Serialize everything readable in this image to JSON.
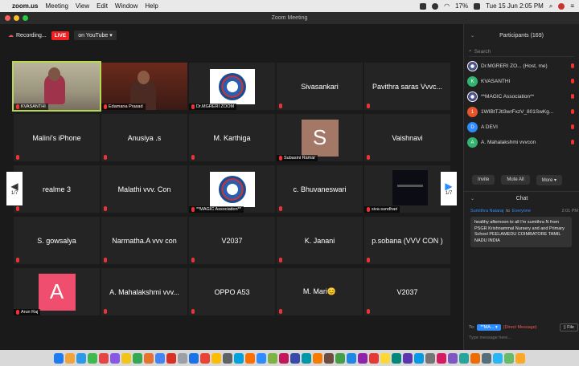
{
  "menubar": {
    "apple": "",
    "app": "zoom.us",
    "items": [
      "Meeting",
      "View",
      "Edit",
      "Window",
      "Help"
    ],
    "battery": "17%",
    "datetime": "Tue 15 Jun  2:05 PM"
  },
  "window": {
    "title": "Zoom Meeting"
  },
  "toolbar": {
    "recording": "Recording...",
    "live": "LIVE",
    "youtube": "on YouTube"
  },
  "tiles": [
    {
      "label": "",
      "name": "KVASANTHI",
      "kind": "video-kv"
    },
    {
      "label": "",
      "name": "Edamana Prasad",
      "kind": "video-ep"
    },
    {
      "label": "",
      "name": "Dr.MGRERI ZOOM",
      "kind": "logo"
    },
    {
      "label": "Sivasankari",
      "name": "",
      "kind": "text"
    },
    {
      "label": "Pavithra saras Vvvc...",
      "name": "",
      "kind": "text"
    },
    {
      "label": "Malini's iPhone",
      "name": "",
      "kind": "text"
    },
    {
      "label": "Anusiya .s",
      "name": "",
      "kind": "text"
    },
    {
      "label": "M. Karthiga",
      "name": "",
      "kind": "text"
    },
    {
      "label": "S",
      "name": "Subasini Ramar",
      "kind": "avatar",
      "color": "#a47866"
    },
    {
      "label": "Vaishnavi",
      "name": "",
      "kind": "text"
    },
    {
      "label": "realme 3",
      "name": "",
      "kind": "text"
    },
    {
      "label": "Malathi vvv. Con",
      "name": "",
      "kind": "text"
    },
    {
      "label": "",
      "name": "**MAGIC Association**",
      "kind": "logo"
    },
    {
      "label": "c. Bhuvaneswari",
      "name": "",
      "kind": "text"
    },
    {
      "label": "",
      "name": "siva sundhari",
      "kind": "darkvideo"
    },
    {
      "label": "S. gowsalya",
      "name": "",
      "kind": "text"
    },
    {
      "label": "Narmatha.A vvv con",
      "name": "",
      "kind": "text"
    },
    {
      "label": "V2037",
      "name": "",
      "kind": "text"
    },
    {
      "label": "K. Janani",
      "name": "",
      "kind": "text"
    },
    {
      "label": "p.sobana (VVV CON )",
      "name": "",
      "kind": "text"
    },
    {
      "label": "A",
      "name": "Arun Raj",
      "kind": "avatar",
      "color": "#ef4e6e"
    },
    {
      "label": "A. Mahalakshmi vvv...",
      "name": "",
      "kind": "text"
    },
    {
      "label": "OPPO A53",
      "name": "",
      "kind": "text"
    },
    {
      "label": "M. Mari😊",
      "name": "",
      "kind": "text"
    },
    {
      "label": "V2037",
      "name": "",
      "kind": "text"
    }
  ],
  "paging": {
    "left": "1/7",
    "right": "1/7"
  },
  "participants": {
    "title": "Participants (169)",
    "search_placeholder": "Search",
    "list": [
      {
        "initial": "",
        "name": "Dr.MGRERI ZO... (Host, me)",
        "color": "#ffffff",
        "logo": true
      },
      {
        "initial": "K",
        "name": "KVASANTHI",
        "color": "#31b46f",
        "logo": false
      },
      {
        "initial": "",
        "name": "**MAGIC Association**",
        "color": "#ffffff",
        "logo": true
      },
      {
        "initial": "1",
        "name": "1WIBtTJtl3wrFxzV_801SwKg...",
        "color": "#e8542c",
        "logo": false
      },
      {
        "initial": "D",
        "name": "A DEVI",
        "color": "#2d8cff",
        "logo": false
      },
      {
        "initial": "A",
        "name": "A. Mahalakshmi vvvcon",
        "color": "#31b46f",
        "logo": false
      }
    ],
    "invite": "Invite",
    "mute_all": "Mute All",
    "more": "More ▾"
  },
  "chat": {
    "title": "Chat",
    "from": "Sumithra Nataraj",
    "to_word": "to",
    "to": "Everyone",
    "time": "2:01 PM",
    "message": "healthy afternoon to all I'm sumithra N from PSGR Krishnammal Nursery and and Primary School PEELAMEDU COIMBATORE TAMIL NADU INDIA",
    "to_label": "To:",
    "to_target": "**MA... ▾",
    "direct": "(Direct Message)",
    "file": "File",
    "placeholder": "Type message here..."
  },
  "colors": {
    "accent": "#2d8cff",
    "active_speaker": "#b4d850",
    "live_red": "#e22222"
  }
}
